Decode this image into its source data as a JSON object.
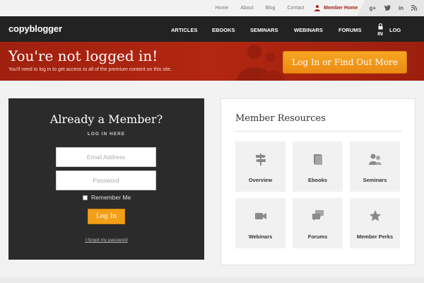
{
  "topbar": {
    "links": [
      "Home",
      "About",
      "Blog",
      "Contact"
    ],
    "member_home": "Member Home",
    "social": [
      "g+",
      "t",
      "in",
      "rss"
    ]
  },
  "nav": {
    "logo": "copyblogger",
    "items": [
      "ARTICLES",
      "EBOOKS",
      "SEMINARS",
      "WEBINARS",
      "FORUMS"
    ],
    "login_line1": "IN",
    "login_line2": "LOG"
  },
  "banner": {
    "title": "You're not logged in!",
    "subtitle": "You'll need to log in to get access to all of the premium content on this site.",
    "cta_label": "Log In or Find Out More"
  },
  "login": {
    "title": "Already a Member?",
    "subtitle": "LOG IN HERE",
    "email_placeholder": "Email Address",
    "password_placeholder": "Password",
    "remember_label": "Remember Me",
    "button_label": "Log In",
    "forgot_label": "I forgot my password"
  },
  "resources": {
    "title": "Member Resources",
    "tiles": [
      {
        "label": "Overview",
        "icon": "signpost-icon"
      },
      {
        "label": "Ebooks",
        "icon": "book-icon"
      },
      {
        "label": "Seminars",
        "icon": "people-icon"
      },
      {
        "label": "Webinars",
        "icon": "video-camera-icon"
      },
      {
        "label": "Forums",
        "icon": "chat-bubbles-icon"
      },
      {
        "label": "Member Perks",
        "icon": "star-icon"
      }
    ]
  },
  "colors": {
    "brand_red": "#a3231a",
    "cta_orange": "#f29f18",
    "nav_dark": "#222222",
    "icon_gray": "#8a8a8a"
  }
}
